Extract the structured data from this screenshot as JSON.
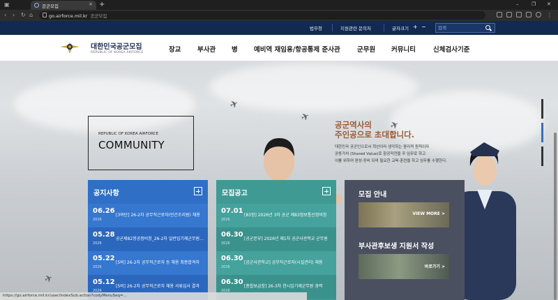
{
  "browser": {
    "tab_title": "공군모집",
    "new_tab": "+",
    "url": "go.airforce.mil.kr",
    "site_name": "공군모집",
    "window": {
      "minimize": "–",
      "restore": "❐",
      "close": "✕"
    }
  },
  "util": {
    "links": [
      "법무청",
      "지원관련 문의처"
    ],
    "font_size_label": "글자크기",
    "font_plus": "+",
    "font_minus": "−",
    "search_placeholder": "검색"
  },
  "logo": {
    "title": "대한민국공군모집",
    "subtitle": "REPUBLIC OF KOREA AIRFORCE"
  },
  "menu": [
    "장교",
    "부사관",
    "병",
    "예비역 재임용/항공통제 준사관",
    "군무원",
    "커뮤니티",
    "신체검사기준"
  ],
  "hero": {
    "kicker": "REPUBLIC OF KOREA AIRFORCE",
    "title": "COMMUNITY",
    "headline1": "공군역사의",
    "headline2": "주인공으로 초대합니다.",
    "desc1": "대한민국 공군인으로서 최선이라 생각하는 윤리적 원칙이자",
    "desc2": "공동가치 (Shared Value)로 항공작전을 주 임무로 하고",
    "desc3": "이를 위하여 편성·장비 되며 필요한 교육·훈련을 하고 임무를 수행한다."
  },
  "notice": {
    "title": "공지사항",
    "rows": [
      {
        "date": "06.26",
        "year": "2026",
        "text": "[3여단] 26-2차 공무직근로자(민간조리원) 채용"
      },
      {
        "date": "05.28",
        "year": "2026",
        "text": "공군제82항공정비창_26-2차 일반임기제군무원 채용"
      },
      {
        "date": "05.22",
        "year": "2026",
        "text": "[5비] 26-2차 공무직근로자 등 채용 최종합격자"
      },
      {
        "date": "05.12",
        "year": "2026",
        "text": "[5비] 26-2차 공무직근로자 채용 서류심사 결과"
      }
    ]
  },
  "recruit": {
    "title": "모집공고",
    "rows": [
      {
        "date": "07.01",
        "year": "2026",
        "text": "[83항] 2026년 3차 공군 제83정보통신정비창"
      },
      {
        "date": "06.30",
        "year": "2026",
        "text": "[공군본부] 2026년 제1차 공군사관학교 군무원"
      },
      {
        "date": "06.30",
        "year": "2026",
        "text": "[공군사관학교] 공무직근로자(시설관리) 채용"
      },
      {
        "date": "06.30",
        "year": "2026",
        "text": "[종합보급창] 26-3차 한시임기제군무원 경력"
      }
    ]
  },
  "guide": {
    "title1": "모집 안내",
    "btn1": "VIEW MORE >",
    "title2": "부사관후보생 지원서 작성",
    "btn2": "바로가기 >"
  },
  "status_text": "https://go.airforce.mil.kr/user/indexSub.action?codyMenuSeq=...",
  "colors": {
    "navy": "#122a52",
    "blue_board": "#2f6fc6",
    "teal_board": "#3f9a94",
    "gray_board": "#4b5060",
    "headline": "#9a5a34"
  }
}
